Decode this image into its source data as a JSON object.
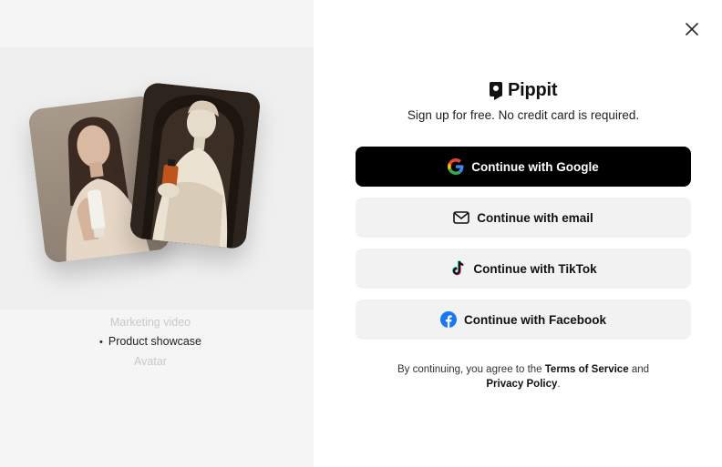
{
  "brand": {
    "name": "Pippit"
  },
  "header": {
    "subtitle": "Sign up for free. No credit card is required."
  },
  "showcase": {
    "modes": [
      "Marketing video",
      "Product showcase",
      "Avatar"
    ],
    "active_mode": "Product showcase"
  },
  "auth": {
    "google_label": "Continue with Google",
    "email_label": "Continue with email",
    "tiktok_label": "Continue with TikTok",
    "facebook_label": "Continue with Facebook"
  },
  "legal": {
    "prefix": "By continuing, you agree to the",
    "terms": "Terms of Service",
    "and": "and",
    "privacy": "Privacy Policy",
    "suffix": "."
  },
  "icons": {
    "close": "close-icon",
    "logo": "pippit-logo-icon",
    "google": "google-icon",
    "email": "mail-icon",
    "tiktok": "tiktok-icon",
    "facebook": "facebook-icon"
  },
  "colors": {
    "primary_button": "#000000",
    "secondary_button": "#f2f2f2",
    "facebook": "#1877f2",
    "left_panel": "#f5f5f5"
  }
}
